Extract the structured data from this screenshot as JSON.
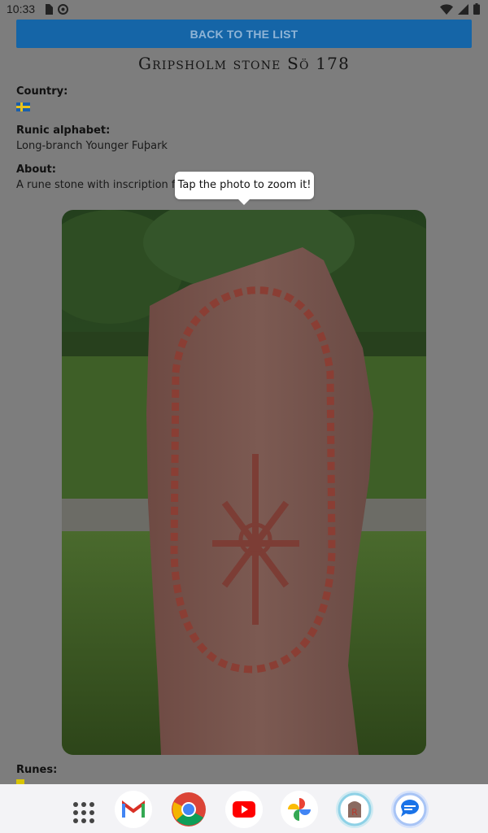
{
  "status_bar": {
    "time": "10:33",
    "icons": [
      "sim-card-icon",
      "data-saver-icon",
      "wifi-icon",
      "signal-icon",
      "battery-icon"
    ]
  },
  "back_button_label": "BACK TO THE LIST",
  "stone_title": "Gripsholm stone Sö 178",
  "fields": {
    "country_label": "Country:",
    "country_flag": "sweden-flag",
    "runic_alphabet_label": "Runic alphabet:",
    "runic_alphabet_value": "Long-branch Younger Fuþark",
    "about_label": "About:",
    "about_value": "A rune stone with inscription fro"
  },
  "tooltip_text": "Tap the photo to zoom it!",
  "photo_alt": "rune-stone-photo",
  "runes_label": "Runes:",
  "dock": {
    "apps": [
      "app-drawer-icon",
      "gmail-icon",
      "chrome-icon",
      "youtube-icon",
      "photos-icon",
      "runestone-app-icon",
      "messages-icon"
    ]
  },
  "colors": {
    "accent": "#1565a7",
    "scrim": "#7d7d7d"
  }
}
